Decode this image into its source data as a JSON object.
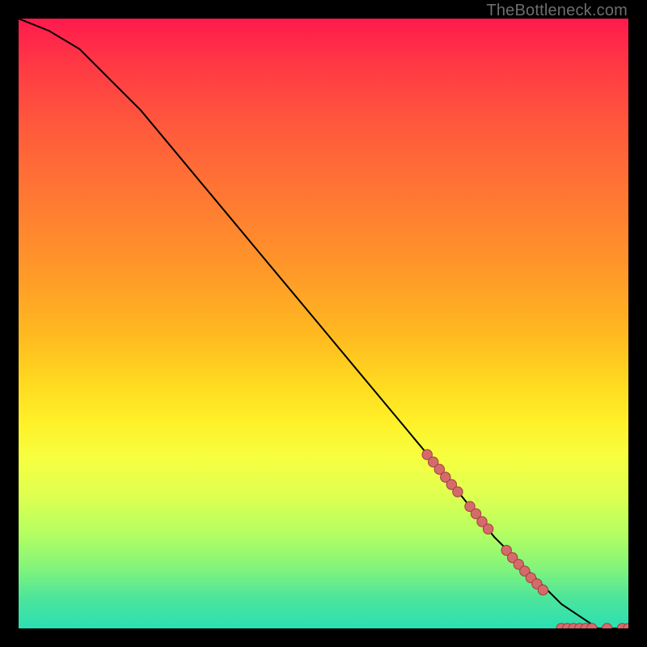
{
  "watermark": "TheBottleneck.com",
  "chart_data": {
    "type": "line",
    "title": "",
    "xlabel": "",
    "ylabel": "",
    "xlim": [
      0,
      100
    ],
    "ylim": [
      0,
      100
    ],
    "series": [
      {
        "name": "curve",
        "x": [
          0,
          5,
          10,
          15,
          20,
          25,
          30,
          35,
          40,
          45,
          50,
          55,
          60,
          65,
          70,
          74,
          78,
          82,
          86,
          89,
          92,
          95,
          100
        ],
        "y": [
          100,
          98,
          95,
          90,
          85,
          79,
          73,
          67,
          61,
          55,
          49,
          43,
          37,
          31,
          25,
          20,
          15,
          11,
          7,
          4,
          2,
          0,
          0
        ]
      }
    ],
    "markers": [
      {
        "x": 67.0,
        "y": 28.5
      },
      {
        "x": 68.0,
        "y": 27.3
      },
      {
        "x": 69.0,
        "y": 26.1
      },
      {
        "x": 70.0,
        "y": 24.8
      },
      {
        "x": 71.0,
        "y": 23.6
      },
      {
        "x": 72.0,
        "y": 22.4
      },
      {
        "x": 74.0,
        "y": 20.0
      },
      {
        "x": 75.0,
        "y": 18.8
      },
      {
        "x": 76.0,
        "y": 17.5
      },
      {
        "x": 77.0,
        "y": 16.3
      },
      {
        "x": 80.0,
        "y": 12.8
      },
      {
        "x": 81.0,
        "y": 11.6
      },
      {
        "x": 82.0,
        "y": 10.5
      },
      {
        "x": 83.0,
        "y": 9.4
      },
      {
        "x": 84.0,
        "y": 8.3
      },
      {
        "x": 85.0,
        "y": 7.3
      },
      {
        "x": 86.0,
        "y": 6.3
      },
      {
        "x": 89.0,
        "y": 0.0
      },
      {
        "x": 90.0,
        "y": 0.0
      },
      {
        "x": 91.0,
        "y": 0.0
      },
      {
        "x": 92.0,
        "y": 0.0
      },
      {
        "x": 93.0,
        "y": 0.0
      },
      {
        "x": 94.0,
        "y": 0.0
      },
      {
        "x": 96.5,
        "y": 0.0
      },
      {
        "x": 99.0,
        "y": 0.0
      },
      {
        "x": 100.0,
        "y": 0.0
      }
    ],
    "marker_style": {
      "fill": "#d66a6a",
      "stroke": "#9e3f3f",
      "radius_px": 6.2
    }
  }
}
